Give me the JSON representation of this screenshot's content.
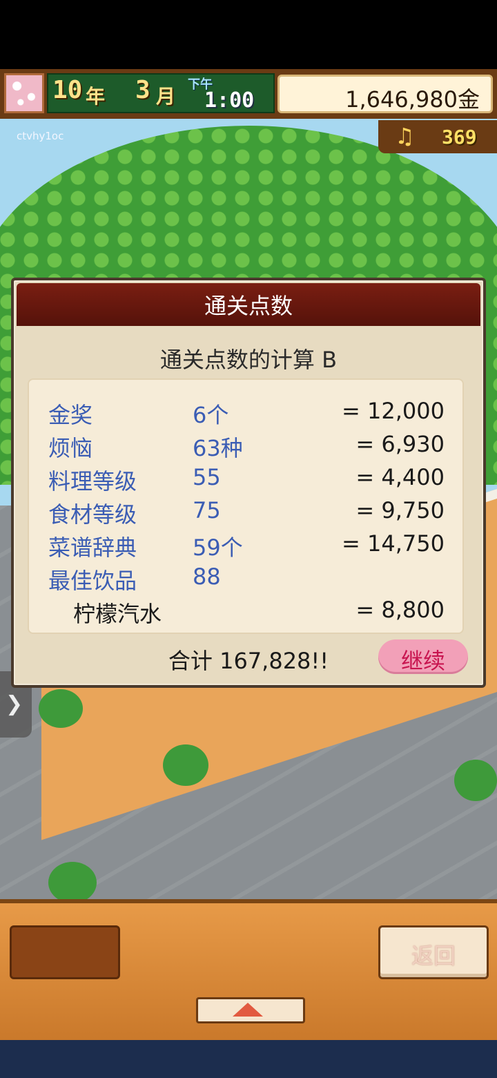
{
  "status_bar": {
    "year_number": "10",
    "year_label": "年",
    "month_number": "3",
    "month_label": "月",
    "ampm": "下午",
    "time": "1:00",
    "money": "1,646,980金"
  },
  "watermark": "ctvhy1oc",
  "music_points": "369",
  "dialog": {
    "title": "通关点数",
    "subtitle": "通关点数的计算 B",
    "rows": [
      {
        "label": "金奖",
        "count": "6个",
        "value": "= 12,000"
      },
      {
        "label": "烦恼",
        "count": "63种",
        "value": "= 6,930"
      },
      {
        "label": "料理等级",
        "count": "55",
        "value": "= 4,400"
      },
      {
        "label": "食材等级",
        "count": "75",
        "value": "= 9,750"
      },
      {
        "label": "菜谱辞典",
        "count": "59个",
        "value": "= 14,750"
      },
      {
        "label": "最佳饮品",
        "count": "88",
        "value": ""
      }
    ],
    "drink_name": "柠檬汽水",
    "drink_value": "= 8,800",
    "total": "合计 167,828!!",
    "continue_label": "继续"
  },
  "bottom": {
    "back_label": "返回"
  }
}
